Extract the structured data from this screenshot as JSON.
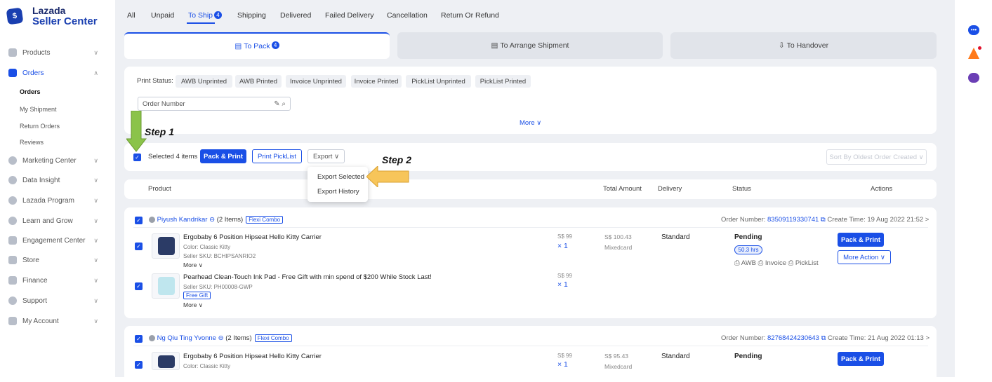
{
  "app": {
    "logo_line1": "Lazada",
    "logo_line2": "Seller Center",
    "logo_glyph": "$"
  },
  "sidebar": {
    "items": [
      {
        "label": "Products"
      },
      {
        "label": "Orders"
      },
      {
        "label": "Marketing Center"
      },
      {
        "label": "Data Insight"
      },
      {
        "label": "Lazada Program"
      },
      {
        "label": "Learn and Grow"
      },
      {
        "label": "Engagement Center"
      },
      {
        "label": "Store"
      },
      {
        "label": "Finance"
      },
      {
        "label": "Support"
      },
      {
        "label": "My Account"
      }
    ],
    "order_subitems": [
      {
        "label": "Orders"
      },
      {
        "label": "My Shipment"
      },
      {
        "label": "Return Orders"
      },
      {
        "label": "Reviews"
      }
    ]
  },
  "tabs": [
    {
      "label": "All"
    },
    {
      "label": "Unpaid"
    },
    {
      "label": "To Ship",
      "badge": "4"
    },
    {
      "label": "Shipping"
    },
    {
      "label": "Delivered"
    },
    {
      "label": "Failed Delivery"
    },
    {
      "label": "Cancellation"
    },
    {
      "label": "Return Or Refund"
    }
  ],
  "subtabs": [
    {
      "label": "To Pack",
      "badge": "4"
    },
    {
      "label": "To Arrange Shipment"
    },
    {
      "label": "To Handover"
    }
  ],
  "filters": {
    "print_status_label": "Print Status:",
    "chips": [
      "AWB Unprinted",
      "AWB Printed",
      "Invoice Unprinted",
      "Invoice Printed",
      "PickList Unprinted",
      "PickList Printed"
    ],
    "search_placeholder": "Order Number",
    "more_label": "More ∨"
  },
  "actions": {
    "selected": "Selected 4 items",
    "pack_print": "Pack & Print",
    "print_picklist": "Print PickList",
    "export": "Export ∨",
    "export_selected": "Export Selected",
    "export_history": "Export History",
    "sort_by": "Sort By",
    "sort_value": "Oldest Order Created ∨"
  },
  "annotations": {
    "step1": "Step 1",
    "step2": "Step 2"
  },
  "table_headers": {
    "product": "Product",
    "total": "Total Amount",
    "delivery": "Delivery",
    "status": "Status",
    "actions": "Actions"
  },
  "orders": [
    {
      "customer": "Piyush Kandrikar",
      "items": "(2 Items)",
      "tag": "Flexi Combo",
      "order_number_label": "Order Number: ",
      "order_number": "83509119330741",
      "create_time": "Create Time: 19 Aug 2022 21:52",
      "products": [
        {
          "name": "Ergobaby 6 Position Hipseat Hello Kitty Carrier",
          "color": "Color: Classic Kitty",
          "sku": "Seller SKU: BCHIPSANRIO2",
          "more": "More ∨",
          "price": "S$ 99",
          "qty": "× 1"
        },
        {
          "name": "Pearhead Clean-Touch Ink Pad - Free Gift with min spend of $200 While Stock Last!",
          "sku": "Seller SKU: PH00008-GWP",
          "gift": "Free Gift",
          "more": "More ∨",
          "price": "S$ 99",
          "qty": "× 1"
        }
      ],
      "total": "S$ 100.43",
      "payment": "Mixedcard",
      "delivery": "Standard",
      "status": "Pending",
      "sla": "50.3 hrs",
      "print_links": "⎙ AWB  ⎙ Invoice  ⎙ PickList",
      "pack_print": "Pack & Print",
      "more_action": "More Action ∨"
    },
    {
      "customer": "Ng Qiu Ting Yvonne",
      "items": "(2 Items)",
      "tag": "Flexi Combo",
      "order_number_label": "Order Number: ",
      "order_number": "82768424230643",
      "create_time": "Create Time: 21 Aug 2022 01:13",
      "products": [
        {
          "name": "Ergobaby 6 Position Hipseat Hello Kitty Carrier",
          "color": "Color: Classic Kitty",
          "price": "S$ 99",
          "qty": "× 1"
        }
      ],
      "total": "S$ 95.43",
      "payment": "Mixedcard",
      "delivery": "Standard",
      "status": "Pending",
      "pack_print": "Pack & Print"
    }
  ],
  "colors": {
    "accent": "#1a4fe6",
    "step_arrow_green": "#8bc34a",
    "step_arrow_yellow": "#f7c55a"
  }
}
